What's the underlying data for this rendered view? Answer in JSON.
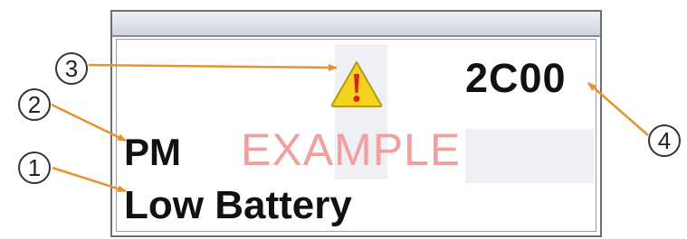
{
  "display": {
    "code": "2C00",
    "mode": "PM",
    "fault_message": "Low Battery",
    "watermark": "EXAMPLE"
  },
  "icons": {
    "warning": "warning-icon"
  },
  "callouts": [
    {
      "number": "1",
      "target": "fault-message"
    },
    {
      "number": "2",
      "target": "mode-indicator"
    },
    {
      "number": "3",
      "target": "warning-icon"
    },
    {
      "number": "4",
      "target": "status-code"
    }
  ],
  "colors": {
    "arrow": "#e8922e",
    "warning_fill": "#f4d21f",
    "warning_mark": "#d8241c",
    "watermark": "#f0a0a0",
    "text": "#111111"
  }
}
